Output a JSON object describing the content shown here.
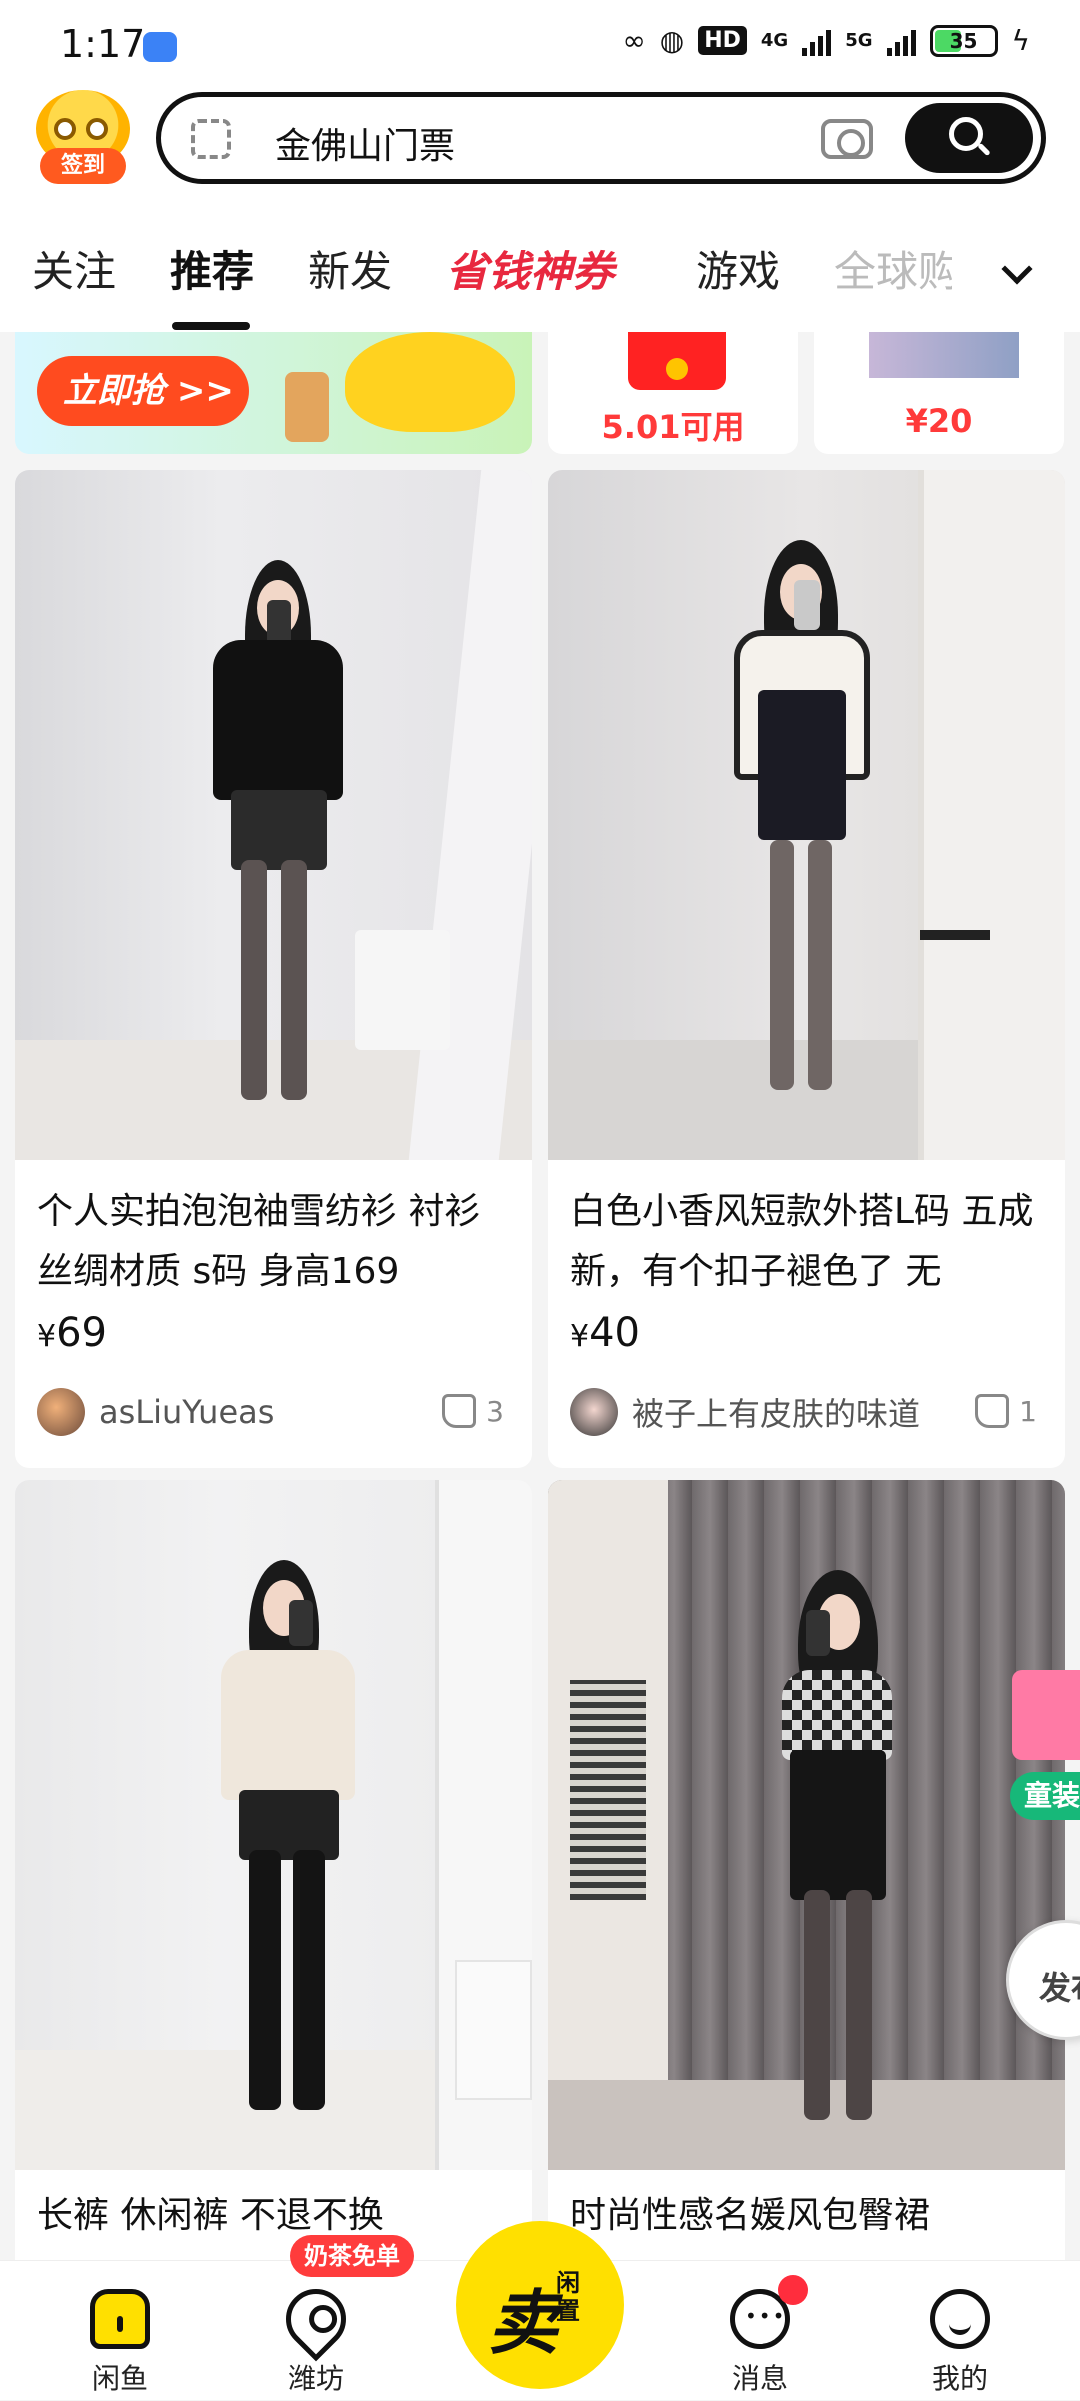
{
  "status_bar": {
    "time": "1:17",
    "hd": "HD",
    "network_1": "4G",
    "network_2": "5G",
    "battery": "35"
  },
  "header": {
    "signin_label": "签到",
    "search_text": "金佛山门票"
  },
  "tabs": [
    {
      "label": "关注"
    },
    {
      "label": "推荐"
    },
    {
      "label": "新发"
    },
    {
      "label": "省钱神券"
    },
    {
      "label": "游戏"
    },
    {
      "label": "全球购"
    }
  ],
  "promos": {
    "grab_label": "立即抢 >>",
    "coupon_text": "5.01可用",
    "price_text": "¥20"
  },
  "cards": [
    {
      "title": "个人实拍泡泡袖雪纺衫 衬衫 丝绸材质 s码 身高169",
      "currency": "¥",
      "price": "69",
      "seller": "asLiuYueas",
      "likes": "3"
    },
    {
      "title": "白色小香风短款外搭L码 五成新，有个扣子褪色了 无",
      "currency": "¥",
      "price": "40",
      "seller": "被子上有皮肤的味道",
      "likes": "1"
    },
    {
      "title": "长裤 休闲裤 不退不换"
    },
    {
      "title": "时尚性感名媛风包臀裙"
    }
  ],
  "floating": {
    "kids_tag": "童装",
    "publish": "发布"
  },
  "bottom_nav": {
    "home": "闲鱼",
    "fang": "潍坊",
    "milk_badge": "奶茶免单",
    "sell_big": "卖",
    "sell_sub": "闲置",
    "messages": "消息",
    "me": "我的"
  },
  "colors": {
    "brand_yellow": "#ffe000",
    "promo_red": "#e8283f"
  }
}
